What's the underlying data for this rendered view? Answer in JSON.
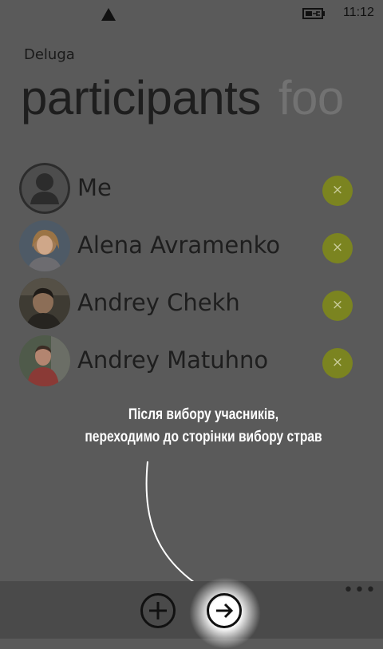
{
  "status_bar": {
    "time": "11:12"
  },
  "app": {
    "title": "Deluga"
  },
  "pivot": {
    "active": "participants",
    "next": "foo"
  },
  "participants": [
    {
      "name": "Me",
      "avatar": "default-person-icon"
    },
    {
      "name": "Alena Avramenko",
      "avatar": "photo"
    },
    {
      "name": "Andrey Chekh",
      "avatar": "photo"
    },
    {
      "name": "Andrey Matuhno",
      "avatar": "photo"
    }
  ],
  "remove_glyph": "×",
  "hint": {
    "line1": "Після вибору учасників,",
    "line2": "переходимо до сторінки вибору страв"
  },
  "app_bar": {
    "more": "•••"
  },
  "colors": {
    "background": "#5a5a5a",
    "accent": "#7b8420",
    "app_bar": "#4a4a4a"
  }
}
